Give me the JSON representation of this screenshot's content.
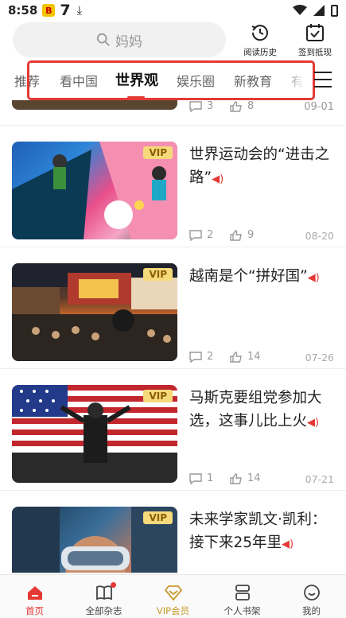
{
  "status_bar": {
    "time": "8:58",
    "app_badge": "B",
    "seven": "7"
  },
  "search": {
    "placeholder": "妈妈"
  },
  "header_actions": {
    "history_label": "阅读历史",
    "checkin_label": "签到抵现"
  },
  "tabs": [
    {
      "label": "推荐",
      "active": false
    },
    {
      "label": "看中国",
      "active": false
    },
    {
      "label": "世界观",
      "active": true
    },
    {
      "label": "娱乐圈",
      "active": false
    },
    {
      "label": "新教育",
      "active": false
    },
    {
      "label": "有",
      "active": false
    }
  ],
  "partial_article": {
    "comments": "3",
    "likes": "8",
    "date": "09-01"
  },
  "articles": [
    {
      "title": "世界运动会的“进击之路”",
      "vip": "VIP",
      "comments": "2",
      "likes": "9",
      "date": "08-20"
    },
    {
      "title": "越南是个“拼好国”",
      "vip": "VIP",
      "comments": "2",
      "likes": "14",
      "date": "07-26"
    },
    {
      "title": "马斯克要组党参加大选，这事儿比上火",
      "vip": "VIP",
      "comments": "1",
      "likes": "14",
      "date": "07-21"
    },
    {
      "title": "未来学家凯文·凯利：接下来25年里",
      "vip": "VIP",
      "comments": "",
      "likes": "",
      "date": ""
    }
  ],
  "bottom_nav": [
    {
      "label": "首页",
      "icon": "home-icon",
      "active": true
    },
    {
      "label": "全部杂志",
      "icon": "book-icon",
      "active": false
    },
    {
      "label": "VIP会员",
      "icon": "diamond-icon",
      "active": false
    },
    {
      "label": "个人书架",
      "icon": "bookshelf-icon",
      "active": false
    },
    {
      "label": "我的",
      "icon": "profile-icon",
      "active": false
    }
  ],
  "colors": {
    "accent": "#e53935",
    "vip_badge": "#f5d97a",
    "vip_text": "#c7992d"
  }
}
